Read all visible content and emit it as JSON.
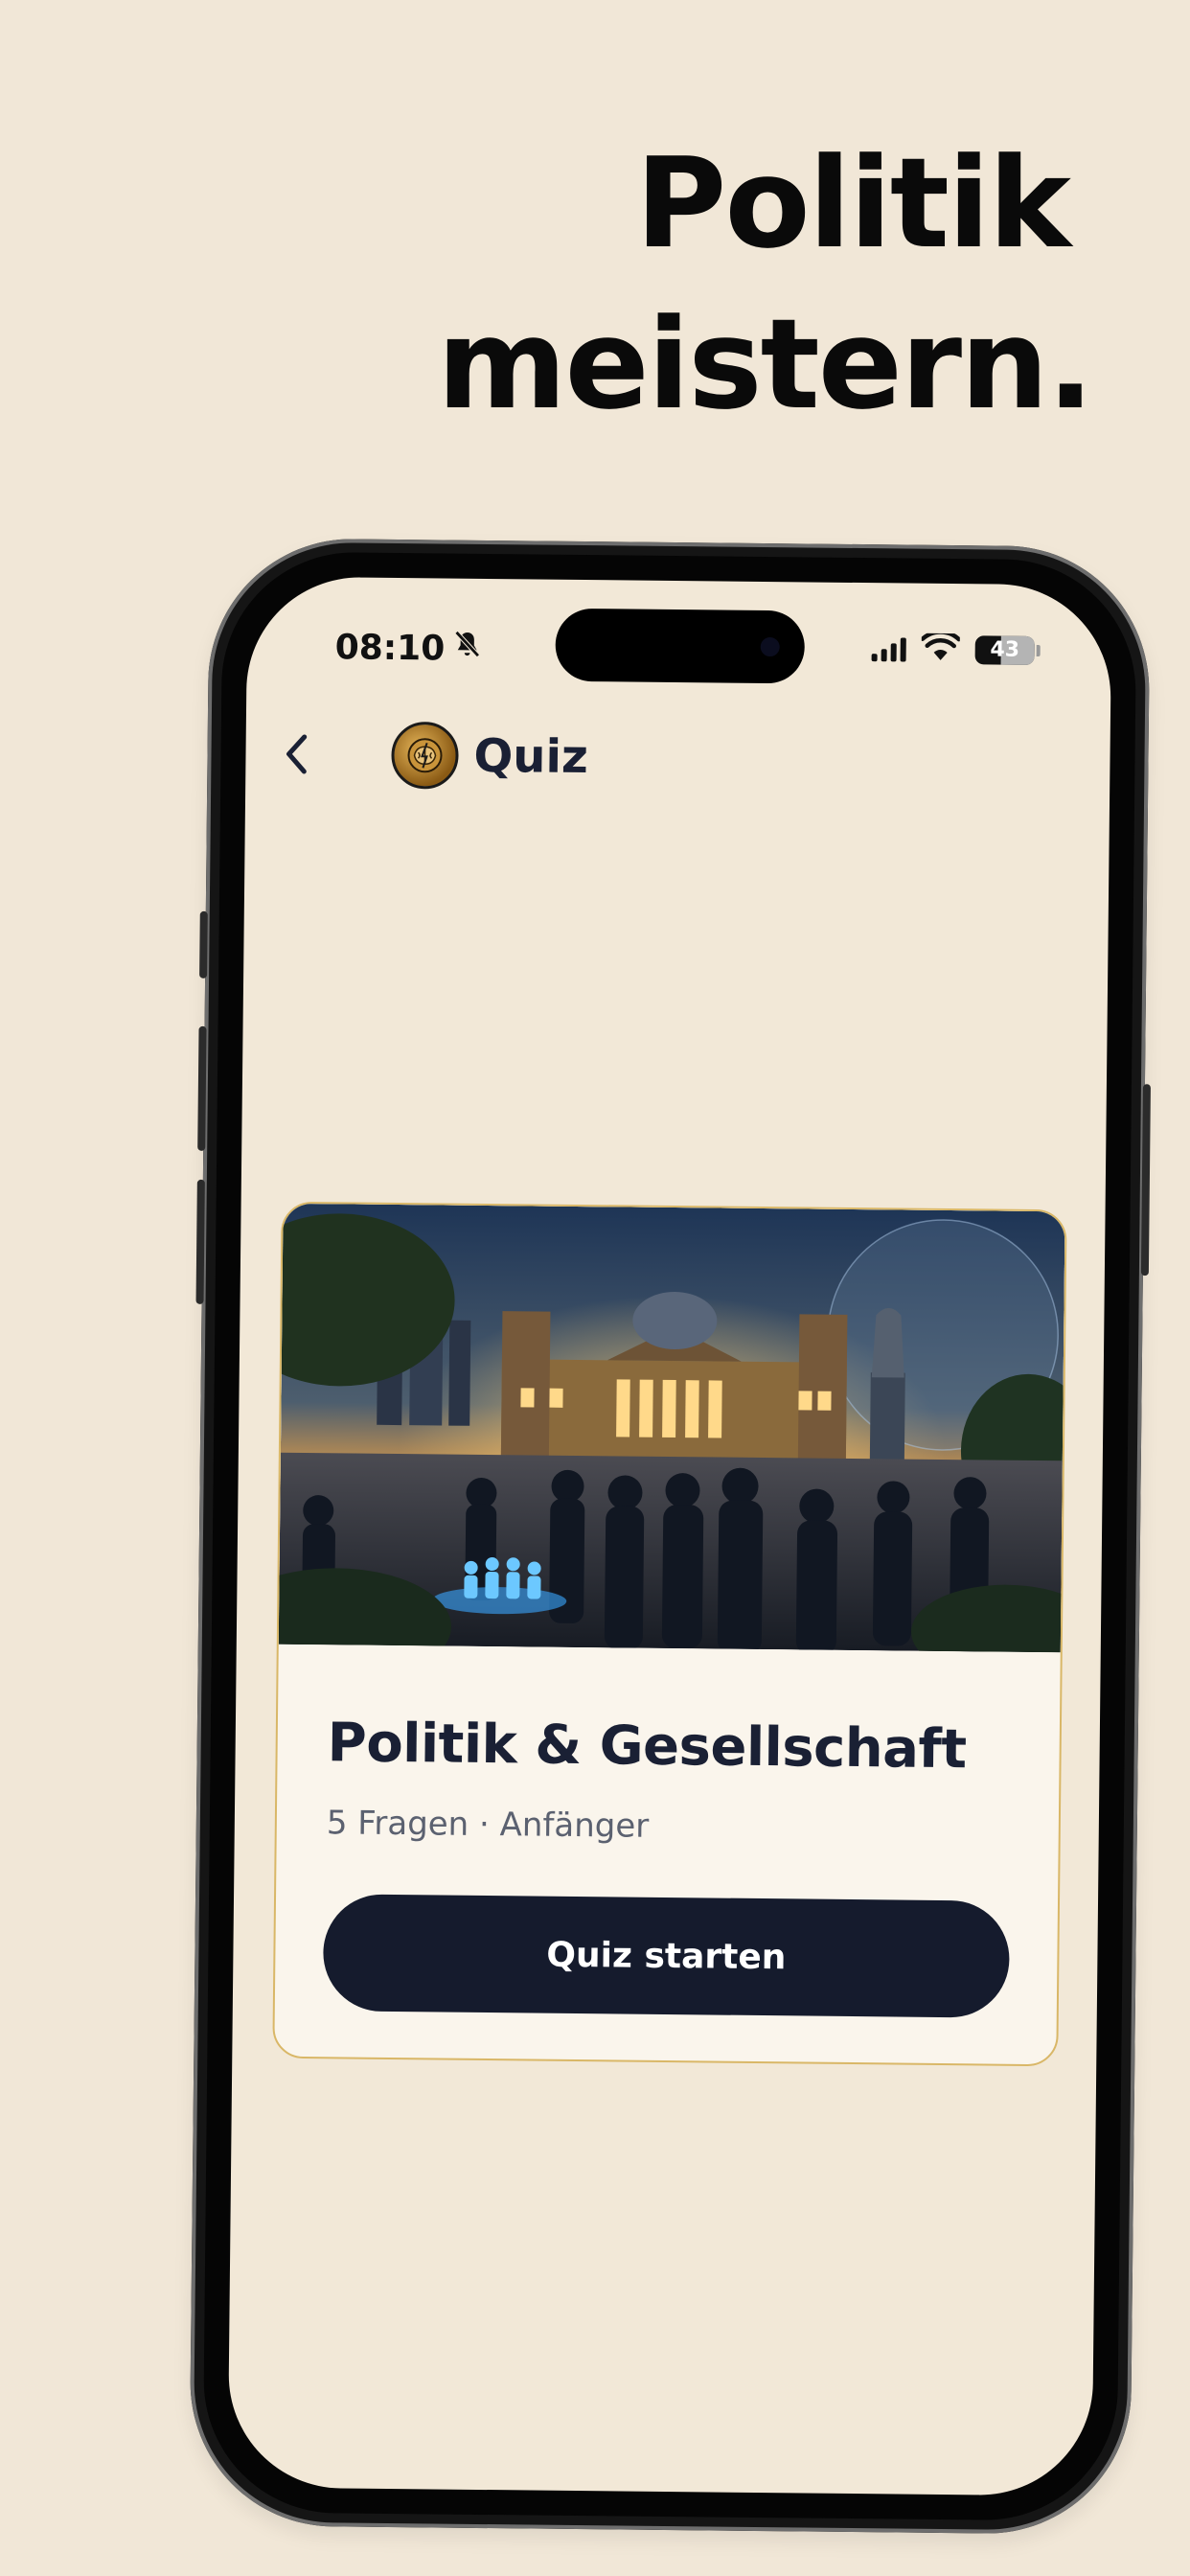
{
  "headline": {
    "line1": "Politik",
    "line2": "meistern."
  },
  "status_bar": {
    "time": "08:10",
    "battery": "43"
  },
  "nav": {
    "title": "Quiz"
  },
  "quiz_card": {
    "title": "Politik & Gesellschaft",
    "meta": "5 Fragen · Anfänger",
    "start_label": "Quiz starten"
  },
  "colors": {
    "background": "#f1e7d7",
    "card_border": "#d9b767",
    "button": "#151b2d",
    "title_text": "#1a2034"
  }
}
